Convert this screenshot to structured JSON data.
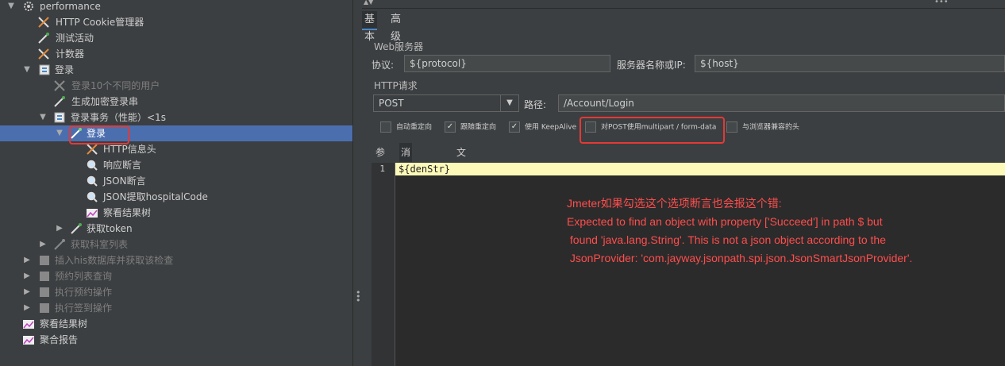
{
  "tree": {
    "items": [
      {
        "label": "performance",
        "icon": "gear-icon",
        "dim": false
      },
      {
        "label": "HTTP Cookie管理器",
        "icon": "wrench-icon",
        "dim": false
      },
      {
        "label": "测试活动",
        "icon": "pipette-icon",
        "dim": false
      },
      {
        "label": "计数器",
        "icon": "wrench-icon",
        "dim": false
      },
      {
        "label": "登录",
        "icon": "controller-icon",
        "dim": false
      },
      {
        "label": "登录10个不同的用户",
        "icon": "wrench-icon",
        "dim": true
      },
      {
        "label": "生成加密登录串",
        "icon": "pipette-icon",
        "dim": false
      },
      {
        "label": "登录事务（性能）<1s",
        "icon": "controller-icon",
        "dim": false
      },
      {
        "label": "登录",
        "icon": "sampler-icon",
        "dim": false
      },
      {
        "label": "HTTP信息头",
        "icon": "wrench-icon",
        "dim": false
      },
      {
        "label": "响应断言",
        "icon": "magnifier-icon",
        "dim": false
      },
      {
        "label": "JSON断言",
        "icon": "magnifier-icon",
        "dim": false
      },
      {
        "label": "JSON提取hospitalCode",
        "icon": "magnifier-icon",
        "dim": false
      },
      {
        "label": "察看结果树",
        "icon": "listener-icon",
        "dim": false
      },
      {
        "label": "获取token",
        "icon": "sampler-icon",
        "dim": false
      },
      {
        "label": "获取科室列表",
        "icon": "pipette-icon",
        "dim": true
      },
      {
        "label": "插入his数据库并获取该检查",
        "icon": "controller-icon",
        "dim": true
      },
      {
        "label": "预约列表查询",
        "icon": "controller-icon",
        "dim": true
      },
      {
        "label": "执行预约操作",
        "icon": "controller-icon",
        "dim": true
      },
      {
        "label": "执行签到操作",
        "icon": "controller-icon",
        "dim": true
      },
      {
        "label": "察看结果树",
        "icon": "listener-icon",
        "dim": false
      },
      {
        "label": "聚合报告",
        "icon": "listener-icon",
        "dim": false
      }
    ]
  },
  "tabs": [
    "基本",
    "高级"
  ],
  "web_server": {
    "title": "Web服务器",
    "protocol_label": "协议:",
    "protocol_value": "${protocol}",
    "server_label": "服务器名称或IP:",
    "server_value": "${host}"
  },
  "http_request": {
    "title": "HTTP请求",
    "method": "POST",
    "path_label": "路径:",
    "path_value": "/Account/Login"
  },
  "checkboxes": [
    {
      "label": "自动重定向",
      "checked": false
    },
    {
      "label": "跟随重定向",
      "checked": true
    },
    {
      "label": "使用 KeepAlive",
      "checked": true
    },
    {
      "label": "对POST使用multipart / form-data",
      "checked": false
    },
    {
      "label": "与浏览器兼容的头",
      "checked": false
    }
  ],
  "sub_tabs": [
    "参数",
    "消息体数据",
    "文件上传"
  ],
  "editor": {
    "line_number": "1",
    "code": "${denStr}"
  },
  "annotation": {
    "line1": "Jmeter如果勾选这个选项断言也会报这个错:",
    "line2": "Expected to find an object with property ['Succeed'] in path $ but",
    "line3": " found 'java.lang.String'. This is not a json object according to the",
    "line4": " JsonProvider: 'com.jayway.jsonpath.spi.json.JsonSmartJsonProvider'."
  },
  "colors": {
    "selection": "#4b6eaf",
    "highlight_line": "#fdf9b8",
    "annotation": "#e53935"
  }
}
